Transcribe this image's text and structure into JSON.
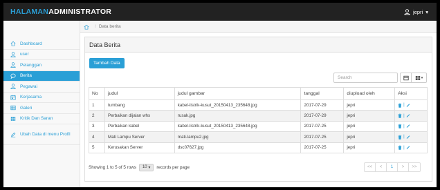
{
  "app": {
    "brand_part1": "HALAMAN",
    "brand_part2": "ADMINISTRATOR",
    "user_name": "jepri",
    "user_caret": "▾"
  },
  "sidebar": {
    "items": [
      {
        "label": "Dashboard",
        "icon": "home-icon"
      },
      {
        "label": "user",
        "icon": "user-icon"
      },
      {
        "label": "Pelanggan",
        "icon": "user-icon"
      },
      {
        "label": "Berita",
        "icon": "comment-icon",
        "active": true
      },
      {
        "label": "Pegawai",
        "icon": "user-icon"
      },
      {
        "label": "Kerjasama",
        "icon": "calendar-icon"
      },
      {
        "label": "Galeri",
        "icon": "list-icon"
      },
      {
        "label": "Kritik Dan Saran",
        "icon": "table-icon"
      },
      {
        "label": "Ubah Data di menu Profil",
        "icon": "pencil-icon"
      }
    ]
  },
  "breadcrumb": {
    "separator": "/",
    "current": "Data berita"
  },
  "panel": {
    "title": "Data Berita",
    "add_button": "Tambah Data",
    "search_placeholder": "Search"
  },
  "table": {
    "headers": [
      "No",
      "judul",
      "judul gambar",
      "tanggal",
      "diupload oleh",
      "Aksi"
    ],
    "rows": [
      [
        "1",
        "tumbang",
        "kabel-listrik-kusut_20150413_235648.jpg",
        "2017-07-29",
        "jepri"
      ],
      [
        "2",
        "Perbaikan dijalan whs",
        "rusak.jpg",
        "2017-07-29",
        "jepri"
      ],
      [
        "3",
        "Perbaikan kabel",
        "kabel-listrik-kusut_20150413_235648.jpg",
        "2017-07-25",
        "jepri"
      ],
      [
        "4",
        "Mati Lampu Server",
        "mati-lampu2.jpg",
        "2017-07-25",
        "jepri"
      ],
      [
        "5",
        "Kerusakan Server",
        "dsc07627.jpg",
        "2017-07-25",
        "jepri"
      ]
    ],
    "action_separator": "|"
  },
  "pagination": {
    "showing_text": "Showing 1 to 5 of 5 rows",
    "rows_per_page": "10",
    "rows_caret": "▾",
    "records_text": "records per page",
    "first": "<<",
    "prev": "<",
    "page": "1",
    "next": ">",
    "last": ">>"
  },
  "colors": {
    "accent": "#2a9fd6",
    "topbar": "#222222"
  }
}
